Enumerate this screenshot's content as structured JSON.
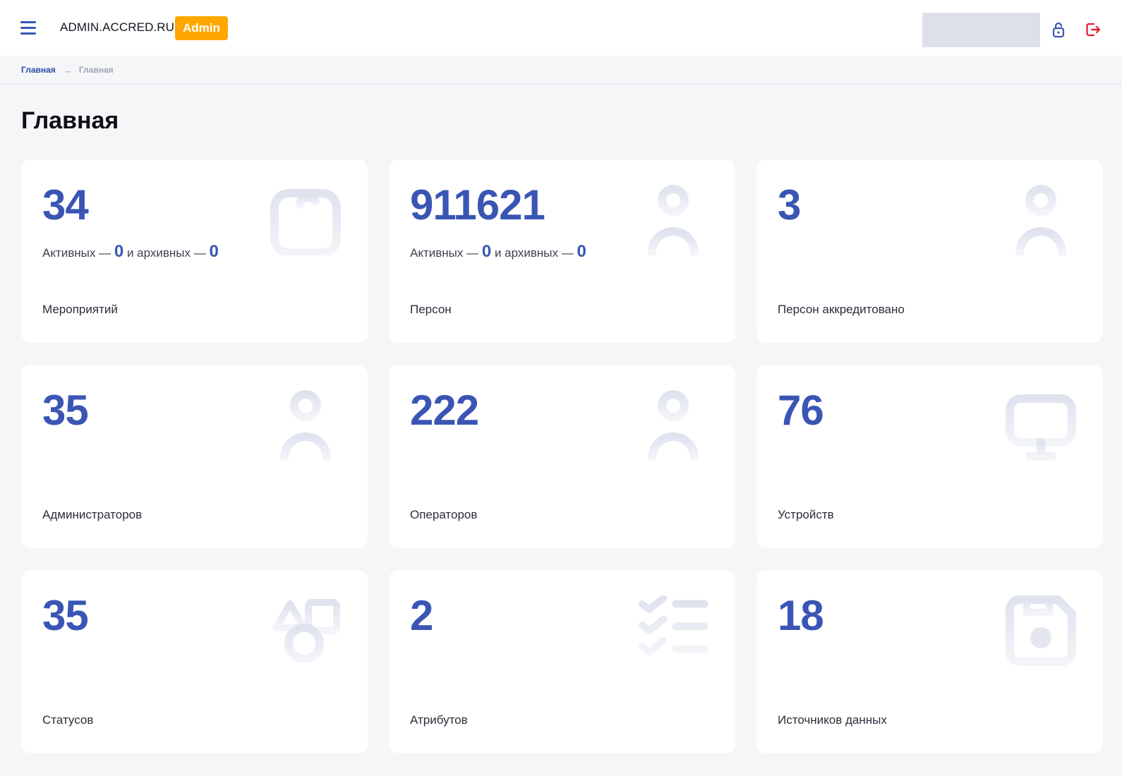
{
  "header": {
    "brand": "ADMIN.ACCRED.RU",
    "role_badge": "Admin",
    "menu_icon": "hamburger-menu-icon",
    "lock_icon": "unlock-icon",
    "logout_icon": "logout-icon",
    "accent_color": "#3a55b4",
    "badge_color": "#ffa600",
    "logout_color": "#e2192c"
  },
  "breadcrumb": {
    "items": [
      "Главная",
      "Главная"
    ]
  },
  "page": {
    "title": "Главная"
  },
  "cards": [
    {
      "value": "34",
      "active_label": "Активных —",
      "active": "0",
      "archive_label": "и архивных —",
      "archive": "0",
      "label": "Мероприятий",
      "icon": "calendar-icon"
    },
    {
      "value": "911621",
      "active_label": "Активных —",
      "active": "0",
      "archive_label": "и архивных —",
      "archive": "0",
      "label": "Персон",
      "icon": "person-icon"
    },
    {
      "value": "3",
      "label": "Персон аккредитовано",
      "icon": "person-icon"
    },
    {
      "value": "35",
      "label": "Администраторов",
      "icon": "person-icon"
    },
    {
      "value": "222",
      "label": "Операторов",
      "icon": "person-icon"
    },
    {
      "value": "76",
      "label": "Устройств",
      "icon": "monitor-icon"
    },
    {
      "value": "35",
      "label": "Статусов",
      "icon": "shapes-icon"
    },
    {
      "value": "2",
      "label": "Атрибутов",
      "icon": "checklist-icon"
    },
    {
      "value": "18",
      "label": "Источников данных",
      "icon": "floppy-disk-icon"
    }
  ]
}
